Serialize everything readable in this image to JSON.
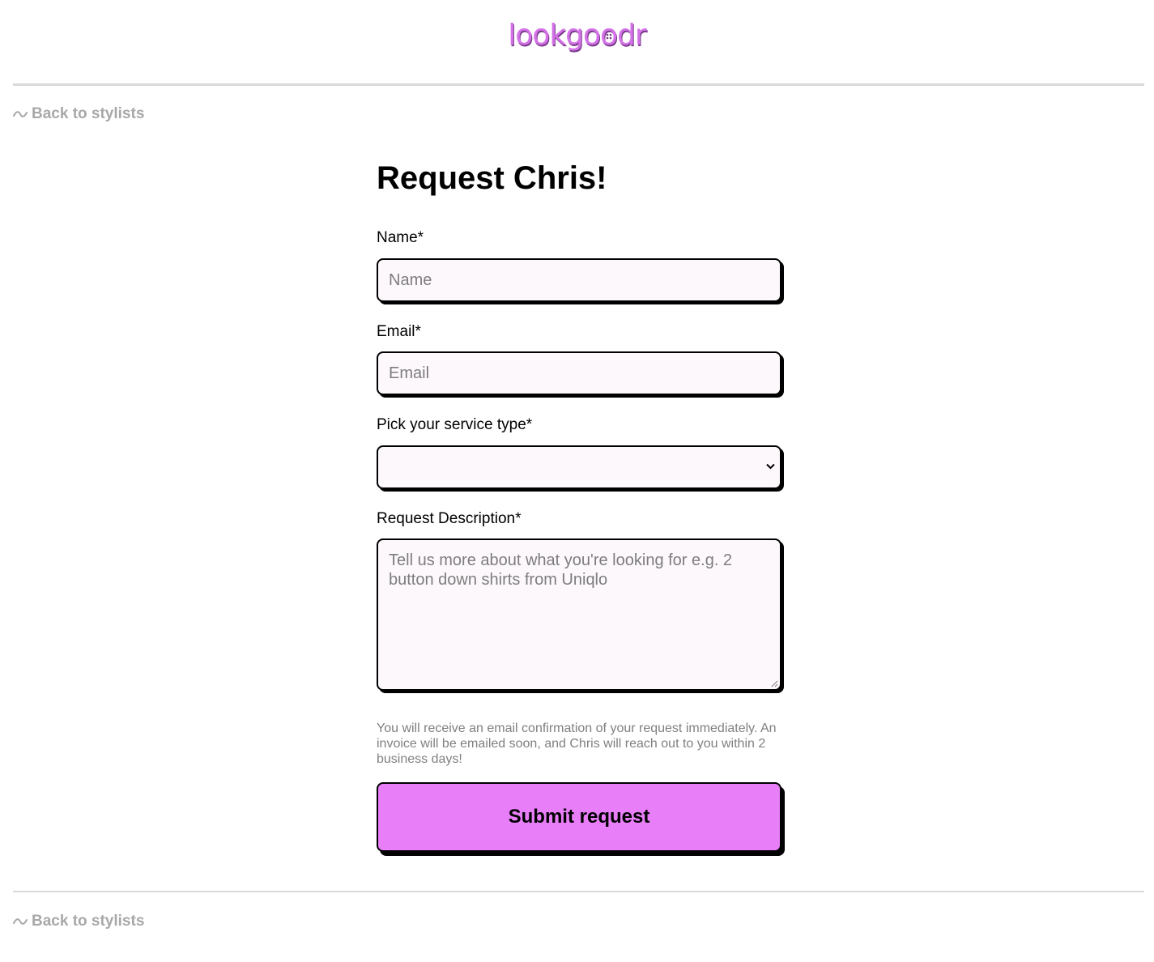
{
  "header": {
    "logo_text": "lookgoodr",
    "logo_color": "#d472e8"
  },
  "nav": {
    "back_label": "Back to stylists",
    "back_icon": "wave-icon"
  },
  "form": {
    "title": "Request Chris!",
    "name": {
      "label": "Name*",
      "placeholder": "Name",
      "value": ""
    },
    "email": {
      "label": "Email*",
      "placeholder": "Email",
      "value": ""
    },
    "service": {
      "label": "Pick your service type*",
      "selected": ""
    },
    "description": {
      "label": "Request Description*",
      "placeholder": "Tell us more about what you're looking for e.g. 2 button down shirts from Uniqlo",
      "value": ""
    },
    "note": "You will receive an email confirmation of your request immediately. An invoice will be emailed soon, and Chris will reach out to you within 2 business days!",
    "submit_label": "Submit request",
    "submit_color": "#e87ef8",
    "field_bg_color": "#fdf8fc"
  }
}
